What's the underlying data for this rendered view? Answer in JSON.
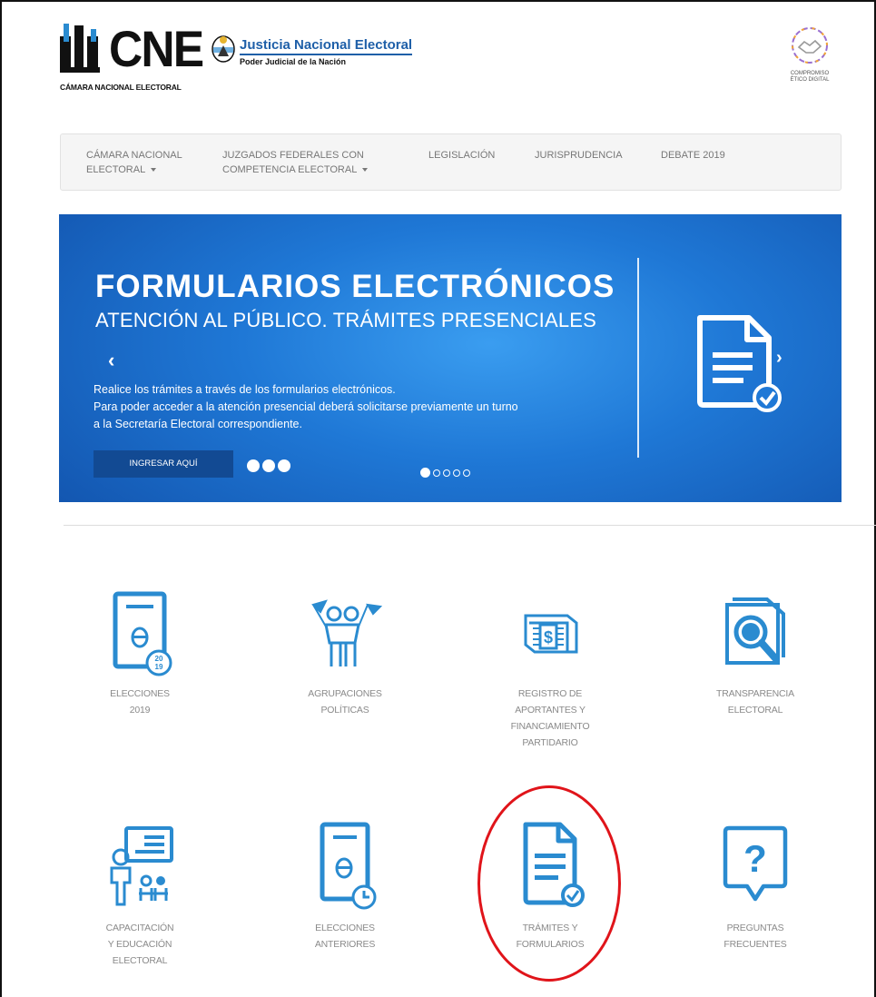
{
  "header": {
    "brand_name": "CNE",
    "brand_subtitle": "CÁMARA NACIONAL ELECTORAL",
    "justice_title": "Justicia Nacional Electoral",
    "justice_subtitle": "Poder Judicial de la Nación",
    "compromiso_line1": "COMPROMISO",
    "compromiso_line2": "ÉTICO DIGITAL"
  },
  "nav": {
    "items": [
      {
        "line1": "CÁMARA NACIONAL",
        "line2": "ELECTORAL"
      },
      {
        "line1": "JUZGADOS FEDERALES CON",
        "line2": "COMPETENCIA ELECTORAL"
      },
      {
        "line1": "LEGISLACIÓN"
      },
      {
        "line1": "JURISPRUDENCIA"
      },
      {
        "line1": "DEBATE 2019"
      }
    ]
  },
  "banner": {
    "title": "FORMULARIOS ELECTRÓNICOS",
    "subtitle": "ATENCIÓN AL PÚBLICO. TRÁMITES PRESENCIALES",
    "paragraph_lines": [
      "Realice los trámites a través de los formularios electrónicos.",
      "Para poder acceder a la atención presencial deberá solicitarse previamente un turno",
      "a la Secretaría Electoral correspondiente."
    ],
    "button_label": "INGRESAR AQUÍ",
    "prev_arrow": "‹",
    "next_arrow": "›",
    "slide_count": 5,
    "active_slide": 1
  },
  "tiles": [
    {
      "lines": [
        "ELECCIONES",
        "2019"
      ],
      "icon": "ballot-2019-icon"
    },
    {
      "lines": [
        "AGRUPACIONES",
        "POLÍTICAS"
      ],
      "icon": "political-groups-icon"
    },
    {
      "lines": [
        "REGISTRO DE",
        "APORTANTES Y",
        "FINANCIAMIENTO",
        "PARTIDARIO"
      ],
      "icon": "money-stack-icon"
    },
    {
      "lines": [
        "TRANSPARENCIA",
        "ELECTORAL"
      ],
      "icon": "magnifier-document-icon"
    },
    {
      "lines": [
        "CAPACITACIÓN",
        "Y EDUCACIÓN",
        "ELECTORAL"
      ],
      "icon": "training-icon"
    },
    {
      "lines": [
        "ELECCIONES",
        "ANTERIORES"
      ],
      "icon": "ballot-history-icon"
    },
    {
      "lines": [
        "TRÁMITES Y",
        "FORMULARIOS"
      ],
      "icon": "form-check-icon"
    },
    {
      "lines": [
        "PREGUNTAS",
        "FRECUENTES"
      ],
      "icon": "question-bubble-icon"
    }
  ],
  "colors": {
    "icon_blue": "#2a8bd0",
    "banner_blue": "#1f78d6",
    "button_blue": "#124a93",
    "highlight_red": "#e0141a"
  }
}
